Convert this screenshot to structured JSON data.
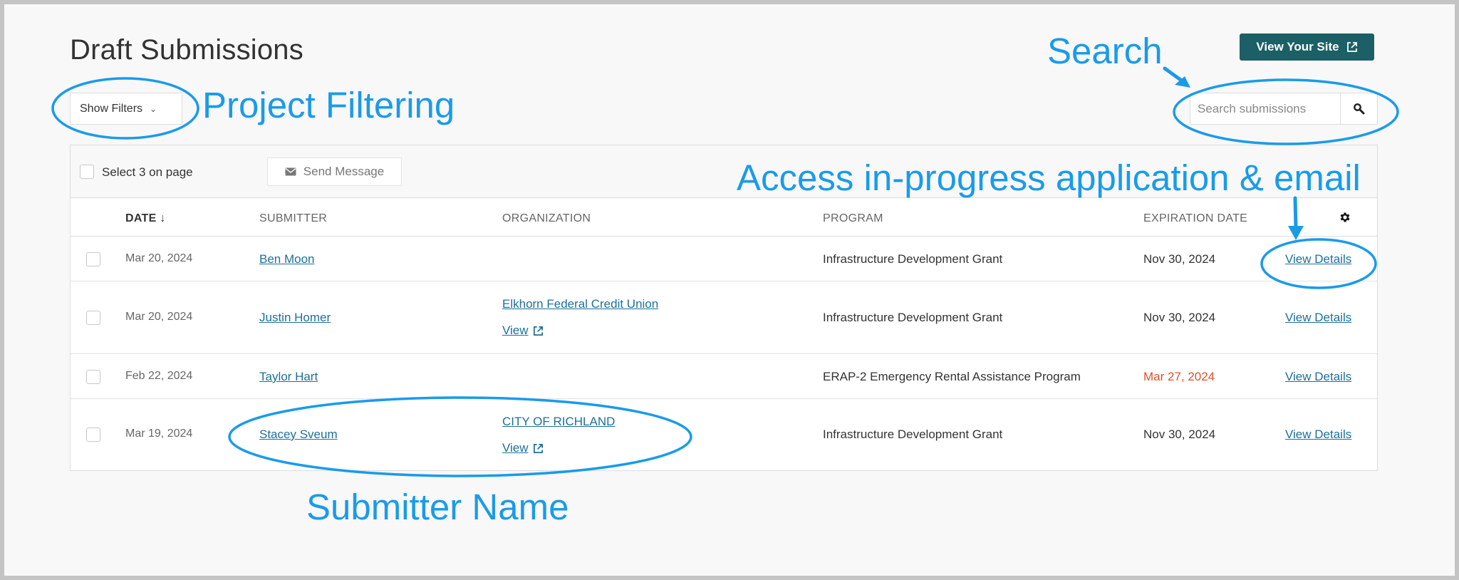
{
  "page": {
    "title": "Draft Submissions",
    "view_site_label": "View Your Site"
  },
  "filters": {
    "label": "Show Filters"
  },
  "search": {
    "placeholder": "Search submissions"
  },
  "toolbar": {
    "select_label": "Select 3 on page",
    "send_message_label": "Send Message"
  },
  "table": {
    "headers": {
      "date": "DATE",
      "date_sort_indicator": "↓",
      "submitter": "SUBMITTER",
      "organization": "ORGANIZATION",
      "program": "PROGRAM",
      "expiration": "EXPIRATION DATE"
    },
    "rows": [
      {
        "date": "Mar 20, 2024",
        "submitter": "Ben Moon",
        "organization": "",
        "org_view": "",
        "program": "Infrastructure Development Grant",
        "expiration": "Nov 30, 2024",
        "expired": false,
        "details": "View Details"
      },
      {
        "date": "Mar 20, 2024",
        "submitter": "Justin Homer",
        "organization": "Elkhorn Federal Credit Union",
        "org_view": "View",
        "program": "Infrastructure Development Grant",
        "expiration": "Nov 30, 2024",
        "expired": false,
        "details": "View Details"
      },
      {
        "date": "Feb 22, 2024",
        "submitter": "Taylor Hart",
        "organization": "",
        "org_view": "",
        "program": "ERAP-2 Emergency Rental Assistance Program",
        "expiration": "Mar 27, 2024",
        "expired": true,
        "details": "View Details"
      },
      {
        "date": "Mar 19, 2024",
        "submitter": "Stacey Sveum",
        "organization": "CITY OF RICHLAND",
        "org_view": "View",
        "program": "Infrastructure Development Grant",
        "expiration": "Nov 30, 2024",
        "expired": false,
        "details": "View Details"
      }
    ]
  },
  "annotations": {
    "project_filtering": "Project Filtering",
    "search": "Search",
    "access": "Access in-progress application & email",
    "submitter_name": "Submitter Name"
  },
  "colors": {
    "brand_button": "#1d5f66",
    "link": "#1e6f9a",
    "expired": "#d9542b",
    "annotation": "#1a9be9"
  },
  "icons": {
    "external_link": "external-link-icon",
    "search": "search-icon",
    "mail": "envelope-icon",
    "settings": "gear-icon",
    "chevron": "chevron-down-icon"
  }
}
